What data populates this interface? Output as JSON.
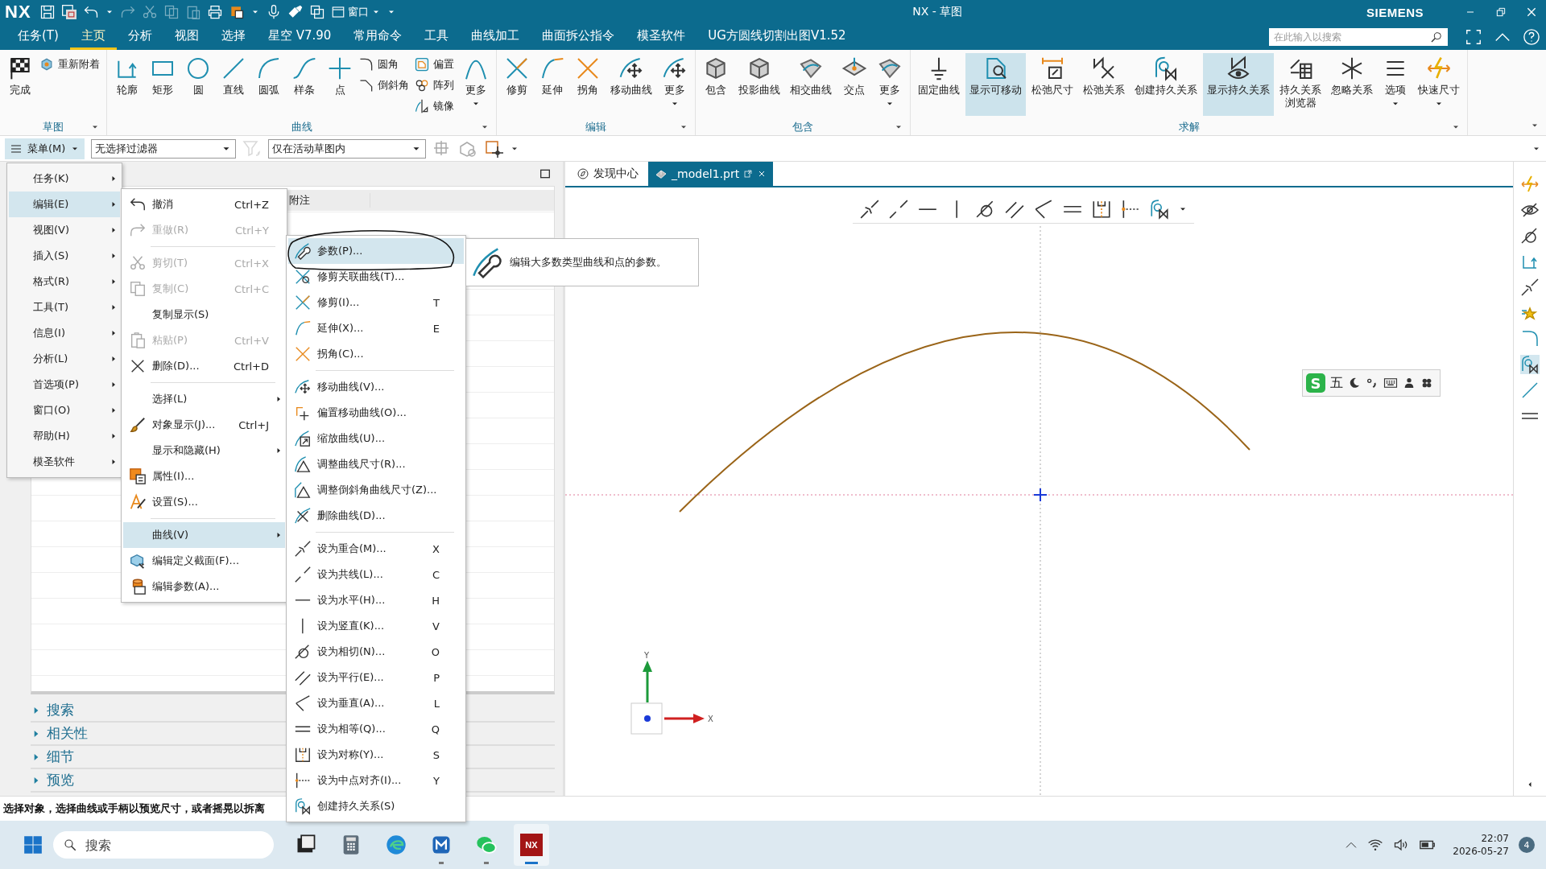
{
  "title_bar": {
    "logo": "NX",
    "window_menu": "窗口",
    "title": "NX - 草图",
    "brand": "SIEMENS"
  },
  "menu_tabs": [
    {
      "label": "任务(T)",
      "selected": false
    },
    {
      "label": "主页",
      "selected": true
    },
    {
      "label": "分析",
      "selected": false
    },
    {
      "label": "视图",
      "selected": false
    },
    {
      "label": "选择",
      "selected": false
    },
    {
      "label": "星空 V7.90",
      "selected": false
    },
    {
      "label": "常用命令",
      "selected": false
    },
    {
      "label": "工具",
      "selected": false
    },
    {
      "label": "曲线加工",
      "selected": false
    },
    {
      "label": "曲面拆公指令",
      "selected": false
    },
    {
      "label": "模圣软件",
      "selected": false
    },
    {
      "label": "UG方圆线切割出图V1.52",
      "selected": false
    }
  ],
  "search": {
    "placeholder": "在此输入以搜索"
  },
  "ribbon": [
    {
      "label": "草图",
      "items": [
        {
          "kind": "large",
          "label": "完成",
          "on": false,
          "more": false
        },
        {
          "kind": "stack",
          "items": [
            "重新附着"
          ]
        }
      ]
    },
    {
      "label": "曲线",
      "items": [
        {
          "kind": "large",
          "label": "轮廓",
          "on": false,
          "more": false
        },
        {
          "kind": "large",
          "label": "矩形",
          "on": false,
          "more": false
        },
        {
          "kind": "large",
          "label": "圆",
          "on": false,
          "more": false
        },
        {
          "kind": "large",
          "label": "直线",
          "on": false,
          "more": false
        },
        {
          "kind": "large",
          "label": "圆弧",
          "on": false,
          "more": false
        },
        {
          "kind": "large",
          "label": "样条",
          "on": false,
          "more": false
        },
        {
          "kind": "large",
          "label": "点",
          "on": false,
          "more": false
        },
        {
          "kind": "stack",
          "items": [
            "圆角",
            "倒斜角"
          ]
        },
        {
          "kind": "stack",
          "items": [
            "偏置",
            "阵列",
            "镜像"
          ]
        },
        {
          "kind": "large",
          "label": "更多",
          "on": false,
          "more": true
        }
      ]
    },
    {
      "label": "编辑",
      "items": [
        {
          "kind": "large",
          "label": "修剪",
          "on": false,
          "more": false
        },
        {
          "kind": "large",
          "label": "延伸",
          "on": false,
          "more": false
        },
        {
          "kind": "large",
          "label": "拐角",
          "on": false,
          "more": false
        },
        {
          "kind": "large",
          "label": "移动曲线",
          "on": false,
          "more": false
        },
        {
          "kind": "large",
          "label": "更多",
          "on": false,
          "more": true
        }
      ]
    },
    {
      "label": "包含",
      "items": [
        {
          "kind": "large",
          "label": "包含",
          "on": false,
          "more": false
        },
        {
          "kind": "large",
          "label": "投影曲线",
          "on": false,
          "more": false
        },
        {
          "kind": "large",
          "label": "相交曲线",
          "on": false,
          "more": false
        },
        {
          "kind": "large",
          "label": "交点",
          "on": false,
          "more": false
        },
        {
          "kind": "large",
          "label": "更多",
          "on": false,
          "more": true
        }
      ]
    },
    {
      "label": "求解",
      "items": [
        {
          "kind": "large",
          "label": "固定曲线",
          "on": false,
          "more": false
        },
        {
          "kind": "large",
          "label": "显示可移动",
          "on": true,
          "more": false
        },
        {
          "kind": "large",
          "label": "松弛尺寸",
          "on": false,
          "more": false
        },
        {
          "kind": "large",
          "label": "松弛关系",
          "on": false,
          "more": false
        },
        {
          "kind": "large",
          "label": "创建持久关系",
          "on": false,
          "more": false
        },
        {
          "kind": "large",
          "label": "显示持久关系",
          "on": true,
          "more": false
        },
        {
          "kind": "large",
          "label": [
            "持久关系",
            "浏览器"
          ],
          "on": false,
          "more": false
        },
        {
          "kind": "large",
          "label": "忽略关系",
          "on": false,
          "more": false
        },
        {
          "kind": "large",
          "label": "选项",
          "on": false,
          "more": true
        },
        {
          "kind": "large",
          "label": "快速尺寸",
          "on": false,
          "more": true
        }
      ]
    }
  ],
  "toolbar": {
    "menu_button": "菜单(M)",
    "filters": [
      {
        "value": "无选择过滤器"
      },
      {
        "value": "仅在活动草图内"
      }
    ]
  },
  "navigator": {
    "column": "附注",
    "sections": [
      {
        "label": "搜索",
        "expanded": false
      },
      {
        "label": "相关性",
        "expanded": false
      },
      {
        "label": "细节",
        "expanded": false
      },
      {
        "label": "预览",
        "expanded": false
      }
    ]
  },
  "document_tabs": [
    {
      "label": "发现中心",
      "selected": false
    },
    {
      "label": "_model1.prt",
      "selected": true
    }
  ],
  "canvas": {
    "axes": {
      "x": "X",
      "y": "Y"
    }
  },
  "ime": {
    "logo": "S",
    "mode": "五"
  },
  "main_menu": [
    {
      "label": "任务(K)",
      "selected": false,
      "submenu": true
    },
    {
      "label": "编辑(E)",
      "selected": true,
      "submenu": true
    },
    {
      "label": "视图(V)",
      "selected": false,
      "submenu": true
    },
    {
      "label": "插入(S)",
      "selected": false,
      "submenu": true
    },
    {
      "label": "格式(R)",
      "selected": false,
      "submenu": true
    },
    {
      "label": "工具(T)",
      "selected": false,
      "submenu": true
    },
    {
      "label": "信息(I)",
      "selected": false,
      "submenu": true
    },
    {
      "label": "分析(L)",
      "selected": false,
      "submenu": true
    },
    {
      "label": "首选项(P)",
      "selected": false,
      "submenu": true
    },
    {
      "label": "窗口(O)",
      "selected": false,
      "submenu": true
    },
    {
      "label": "帮助(H)",
      "selected": false,
      "submenu": true
    },
    {
      "label": "模圣软件",
      "selected": false,
      "submenu": true
    }
  ],
  "edit_menu": [
    {
      "kind": "item",
      "label": "撤消",
      "shortcut": "Ctrl+Z",
      "disabled": false,
      "selected": false,
      "submenu": false
    },
    {
      "kind": "item",
      "label": "重做(R)",
      "shortcut": "Ctrl+Y",
      "disabled": true,
      "selected": false,
      "submenu": false
    },
    {
      "kind": "separator"
    },
    {
      "kind": "item",
      "label": "剪切(T)",
      "shortcut": "Ctrl+X",
      "disabled": true,
      "selected": false,
      "submenu": false
    },
    {
      "kind": "item",
      "label": "复制(C)",
      "shortcut": "Ctrl+C",
      "disabled": true,
      "selected": false,
      "submenu": false
    },
    {
      "kind": "item",
      "label": "复制显示(S)",
      "disabled": false,
      "selected": false,
      "submenu": false
    },
    {
      "kind": "item",
      "label": "粘贴(P)",
      "shortcut": "Ctrl+V",
      "disabled": true,
      "selected": false,
      "submenu": false
    },
    {
      "kind": "item",
      "label": "删除(D)...",
      "shortcut": "Ctrl+D",
      "disabled": false,
      "selected": false,
      "submenu": false
    },
    {
      "kind": "separator"
    },
    {
      "kind": "item",
      "label": "选择(L)",
      "disabled": false,
      "selected": false,
      "submenu": true
    },
    {
      "kind": "item",
      "label": "对象显示(J)...",
      "shortcut": "Ctrl+J",
      "disabled": false,
      "selected": false,
      "submenu": false
    },
    {
      "kind": "item",
      "label": "显示和隐藏(H)",
      "disabled": false,
      "selected": false,
      "submenu": true
    },
    {
      "kind": "item",
      "label": "属性(I)...",
      "disabled": false,
      "selected": false,
      "submenu": false
    },
    {
      "kind": "item",
      "label": "设置(S)...",
      "disabled": false,
      "selected": false,
      "submenu": false
    },
    {
      "kind": "separator"
    },
    {
      "kind": "item",
      "label": "曲线(V)",
      "disabled": false,
      "selected": true,
      "submenu": true
    },
    {
      "kind": "item",
      "label": "编辑定义截面(F)...",
      "disabled": false,
      "selected": false,
      "submenu": false
    },
    {
      "kind": "item",
      "label": "编辑参数(A)...",
      "disabled": false,
      "selected": false,
      "submenu": false
    }
  ],
  "curve_menu": [
    {
      "kind": "item",
      "label": "参数(P)...",
      "selected": true
    },
    {
      "kind": "item",
      "label": "修剪关联曲线(T)...",
      "selected": false
    },
    {
      "kind": "item",
      "label": "修剪(I)...",
      "shortcut": "T",
      "selected": false
    },
    {
      "kind": "item",
      "label": "延伸(X)...",
      "shortcut": "E",
      "selected": false
    },
    {
      "kind": "item",
      "label": "拐角(C)...",
      "selected": false
    },
    {
      "kind": "separator"
    },
    {
      "kind": "item",
      "label": "移动曲线(V)...",
      "selected": false
    },
    {
      "kind": "item",
      "label": "偏置移动曲线(O)...",
      "selected": false
    },
    {
      "kind": "item",
      "label": "缩放曲线(U)...",
      "selected": false
    },
    {
      "kind": "item",
      "label": "调整曲线尺寸(R)...",
      "selected": false
    },
    {
      "kind": "item",
      "label": "调整倒斜角曲线尺寸(Z)...",
      "selected": false
    },
    {
      "kind": "item",
      "label": "删除曲线(D)...",
      "selected": false
    },
    {
      "kind": "separator"
    },
    {
      "kind": "item",
      "label": "设为重合(M)...",
      "shortcut": "X",
      "selected": false
    },
    {
      "kind": "item",
      "label": "设为共线(L)...",
      "shortcut": "C",
      "selected": false
    },
    {
      "kind": "item",
      "label": "设为水平(H)...",
      "shortcut": "H",
      "selected": false
    },
    {
      "kind": "item",
      "label": "设为竖直(K)...",
      "shortcut": "V",
      "selected": false
    },
    {
      "kind": "item",
      "label": "设为相切(N)...",
      "shortcut": "O",
      "selected": false
    },
    {
      "kind": "item",
      "label": "设为平行(E)...",
      "shortcut": "P",
      "selected": false
    },
    {
      "kind": "item",
      "label": "设为垂直(A)...",
      "shortcut": "L",
      "selected": false
    },
    {
      "kind": "item",
      "label": "设为相等(Q)...",
      "shortcut": "Q",
      "selected": false
    },
    {
      "kind": "item",
      "label": "设为对称(Y)...",
      "shortcut": "S",
      "selected": false
    },
    {
      "kind": "item",
      "label": "设为中点对齐(I)...",
      "shortcut": "Y",
      "selected": false
    },
    {
      "kind": "item",
      "label": "创建持久关系(S)",
      "selected": false
    }
  ],
  "tooltip": "编辑大多数类型曲线和点的参数。",
  "status_bar": "选择对象，选择曲线或手柄以预览尺寸，或者摇晃以拆离",
  "taskbar": {
    "search_placeholder": "搜索",
    "apps": [
      {
        "kind": "files",
        "running": false,
        "active": false
      },
      {
        "kind": "calculator",
        "running": false,
        "active": false
      },
      {
        "kind": "browser",
        "running": false,
        "active": false
      },
      {
        "kind": "store",
        "running": true,
        "active": false
      },
      {
        "kind": "chat",
        "running": true,
        "active": false
      },
      {
        "kind": "nx",
        "label": "NX",
        "running": true,
        "active": true
      }
    ],
    "time": "22:07",
    "date": "2026-05-27",
    "notifications": "4"
  }
}
